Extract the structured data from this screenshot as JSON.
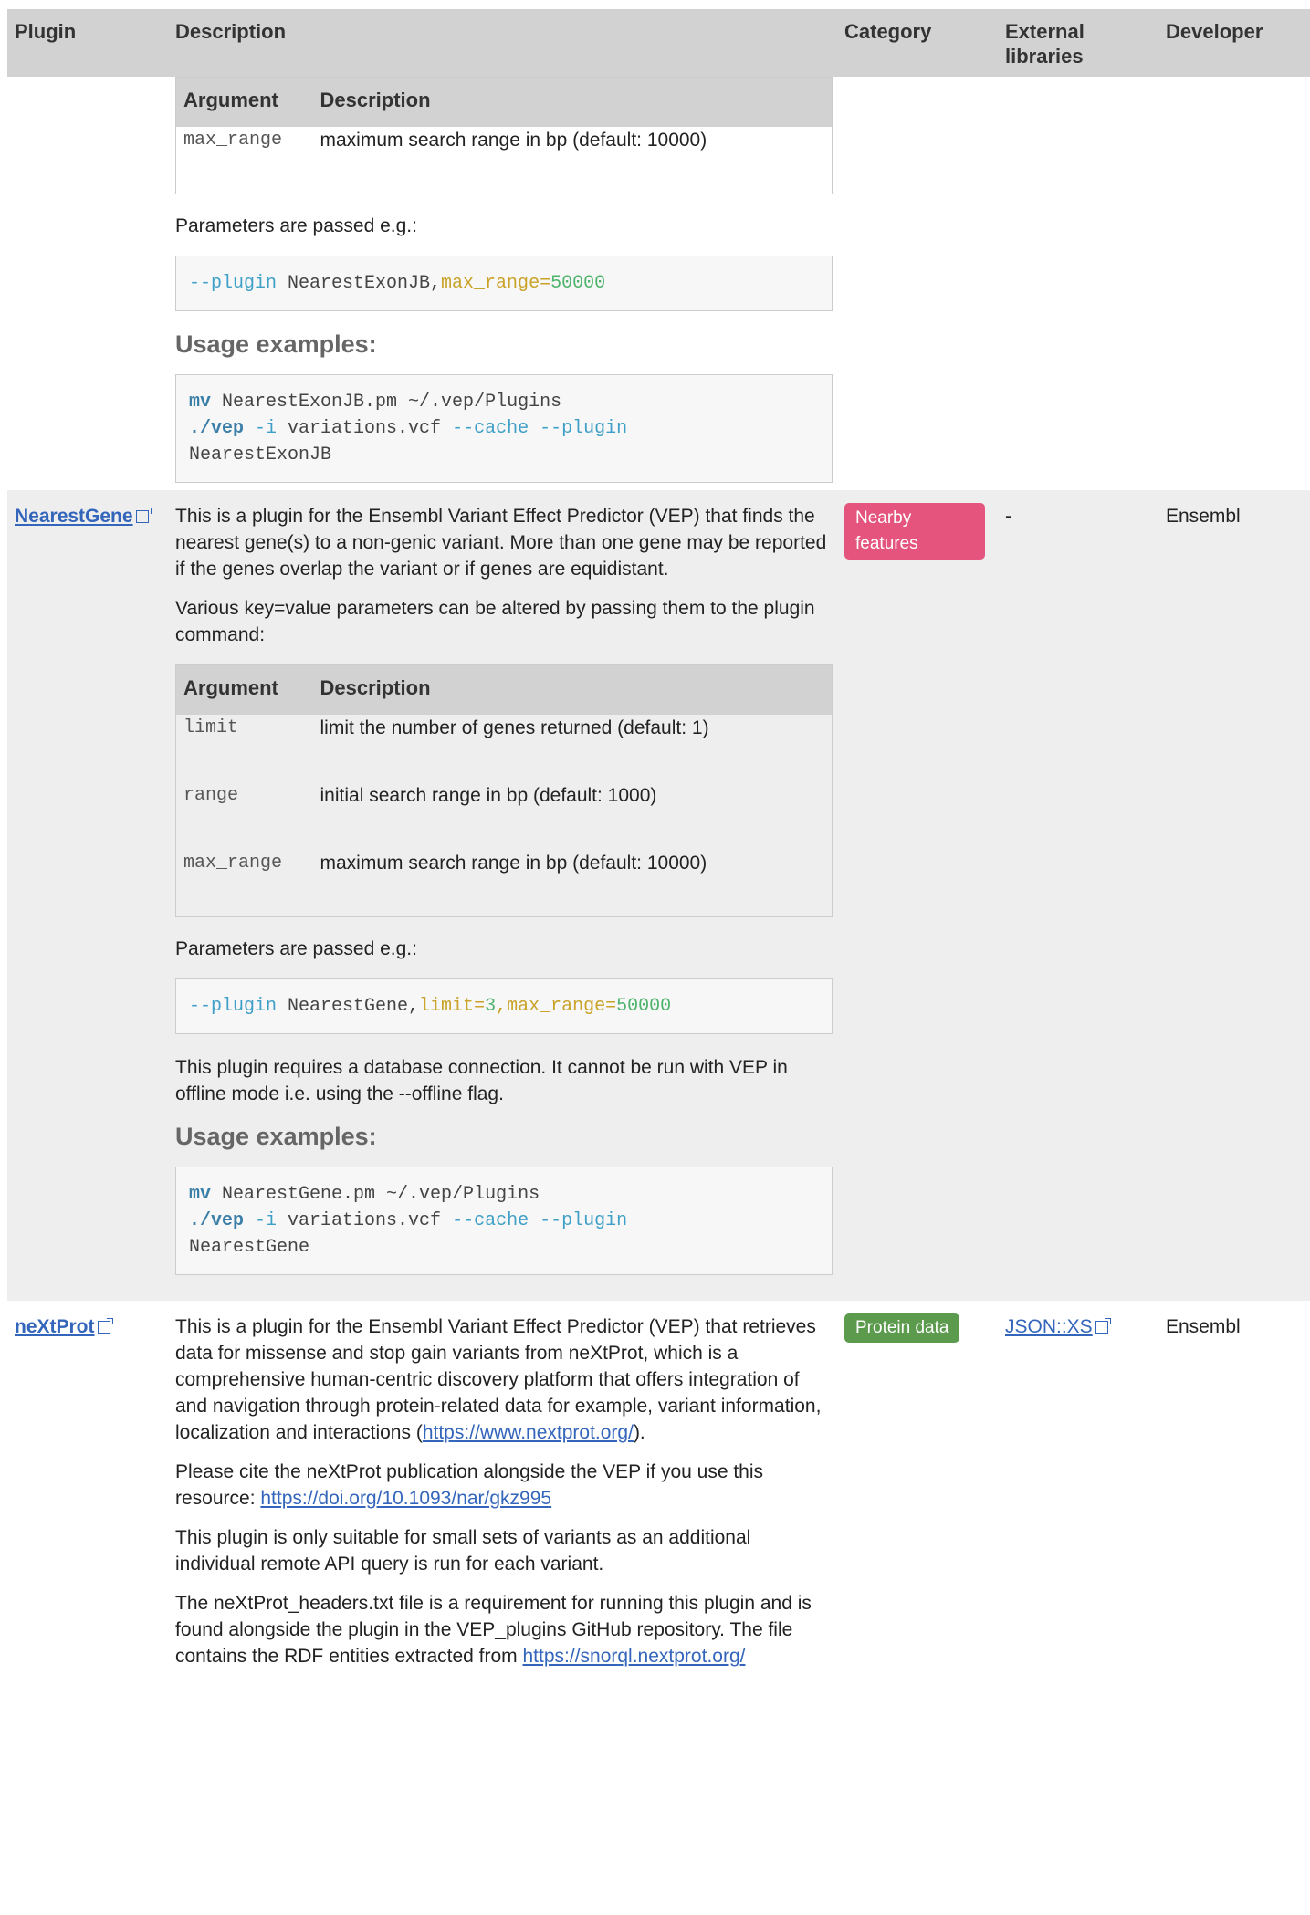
{
  "header": {
    "plugin": "Plugin",
    "description": "Description",
    "category": "Category",
    "external": "External libraries",
    "developer": "Developer"
  },
  "exon": {
    "args_header": {
      "argument": "Argument",
      "description": "Description"
    },
    "args": [
      {
        "name": "max_range",
        "desc": "maximum search range in bp (default: 10000)"
      }
    ],
    "params_text": "Parameters are passed e.g.:",
    "param_code": {
      "flag": "--plugin",
      "name": " NearestExonJB,",
      "key": "max_range",
      "eq": "=",
      "val": "50000"
    },
    "usage_title": "Usage examples:",
    "usage": {
      "mv": "mv",
      "line1": " NearestExonJB.pm ~/.vep/Plugins",
      "vep": "./vep",
      "i": " -i",
      "line2a": " variations.vcf ",
      "cache": "--cache --plugin",
      "line3": "NearestExonJB"
    }
  },
  "nearestgene": {
    "name": "NearestGene",
    "description_1": "This is a plugin for the Ensembl Variant Effect Predictor (VEP) that finds the nearest gene(s) to a non-genic variant. More than one gene may be reported if the genes overlap the variant or if genes are equidistant.",
    "description_2": "Various key=value parameters can be altered by passing them to the plugin command:",
    "args_header": {
      "argument": "Argument",
      "description": "Description"
    },
    "args": [
      {
        "name": "limit",
        "desc": "limit the number of genes returned (default: 1)"
      },
      {
        "name": "range",
        "desc": "initial search range in bp (default: 1000)"
      },
      {
        "name": "max_range",
        "desc": "maximum search range in bp (default: 10000)"
      }
    ],
    "params_text": "Parameters are passed e.g.:",
    "param_code": {
      "flag": "--plugin",
      "name": " NearestGene,",
      "key1": "limit",
      "eq1": "=",
      "val1": "3",
      "comma": ",",
      "key2": "max_range",
      "eq2": "=",
      "val2": "50000"
    },
    "db_note": "This plugin requires a database connection. It cannot be run with VEP in offline mode i.e. using the --offline flag.",
    "usage_title": "Usage examples:",
    "usage": {
      "mv": "mv",
      "line1": " NearestGene.pm ~/.vep/Plugins",
      "vep": "./vep",
      "i": " -i",
      "line2a": " variations.vcf ",
      "cache": "--cache --plugin",
      "line3": "NearestGene"
    },
    "category": "Nearby features",
    "external": "-",
    "developer": "Ensembl"
  },
  "nextprot": {
    "name": "neXtProt",
    "description_1a": "This is a plugin for the Ensembl Variant Effect Predictor (VEP) that retrieves data for missense and stop gain variants from neXtProt, which is a comprehensive human-centric discovery platform that offers integration of and navigation through protein-related data for example, variant information, localization and interactions (",
    "description_1_link": "https://www.nextprot.org/",
    "description_1b": ").",
    "description_2a": "Please cite the neXtProt publication alongside the VEP if you use this resource: ",
    "description_2_link": "https://doi.org/10.1093/nar/gkz995",
    "description_3": "This plugin is only suitable for small sets of variants as an additional individual remote API query is run for each variant.",
    "description_4a": "The neXtProt_headers.txt file is a requirement for running this plugin and is found alongside the plugin in the VEP_plugins GitHub repository. The file contains the RDF entities extracted from ",
    "description_4_link": "https://snorql.nextprot.org/",
    "category": "Protein data",
    "external": "JSON::XS",
    "developer": "Ensembl"
  },
  "colors": {
    "header_bg": "#d2d2d2",
    "row_alt_bg": "#eeeeee",
    "link": "#3366bb",
    "badge_nearby": "#e4547c",
    "badge_protein": "#5c9a4d"
  }
}
